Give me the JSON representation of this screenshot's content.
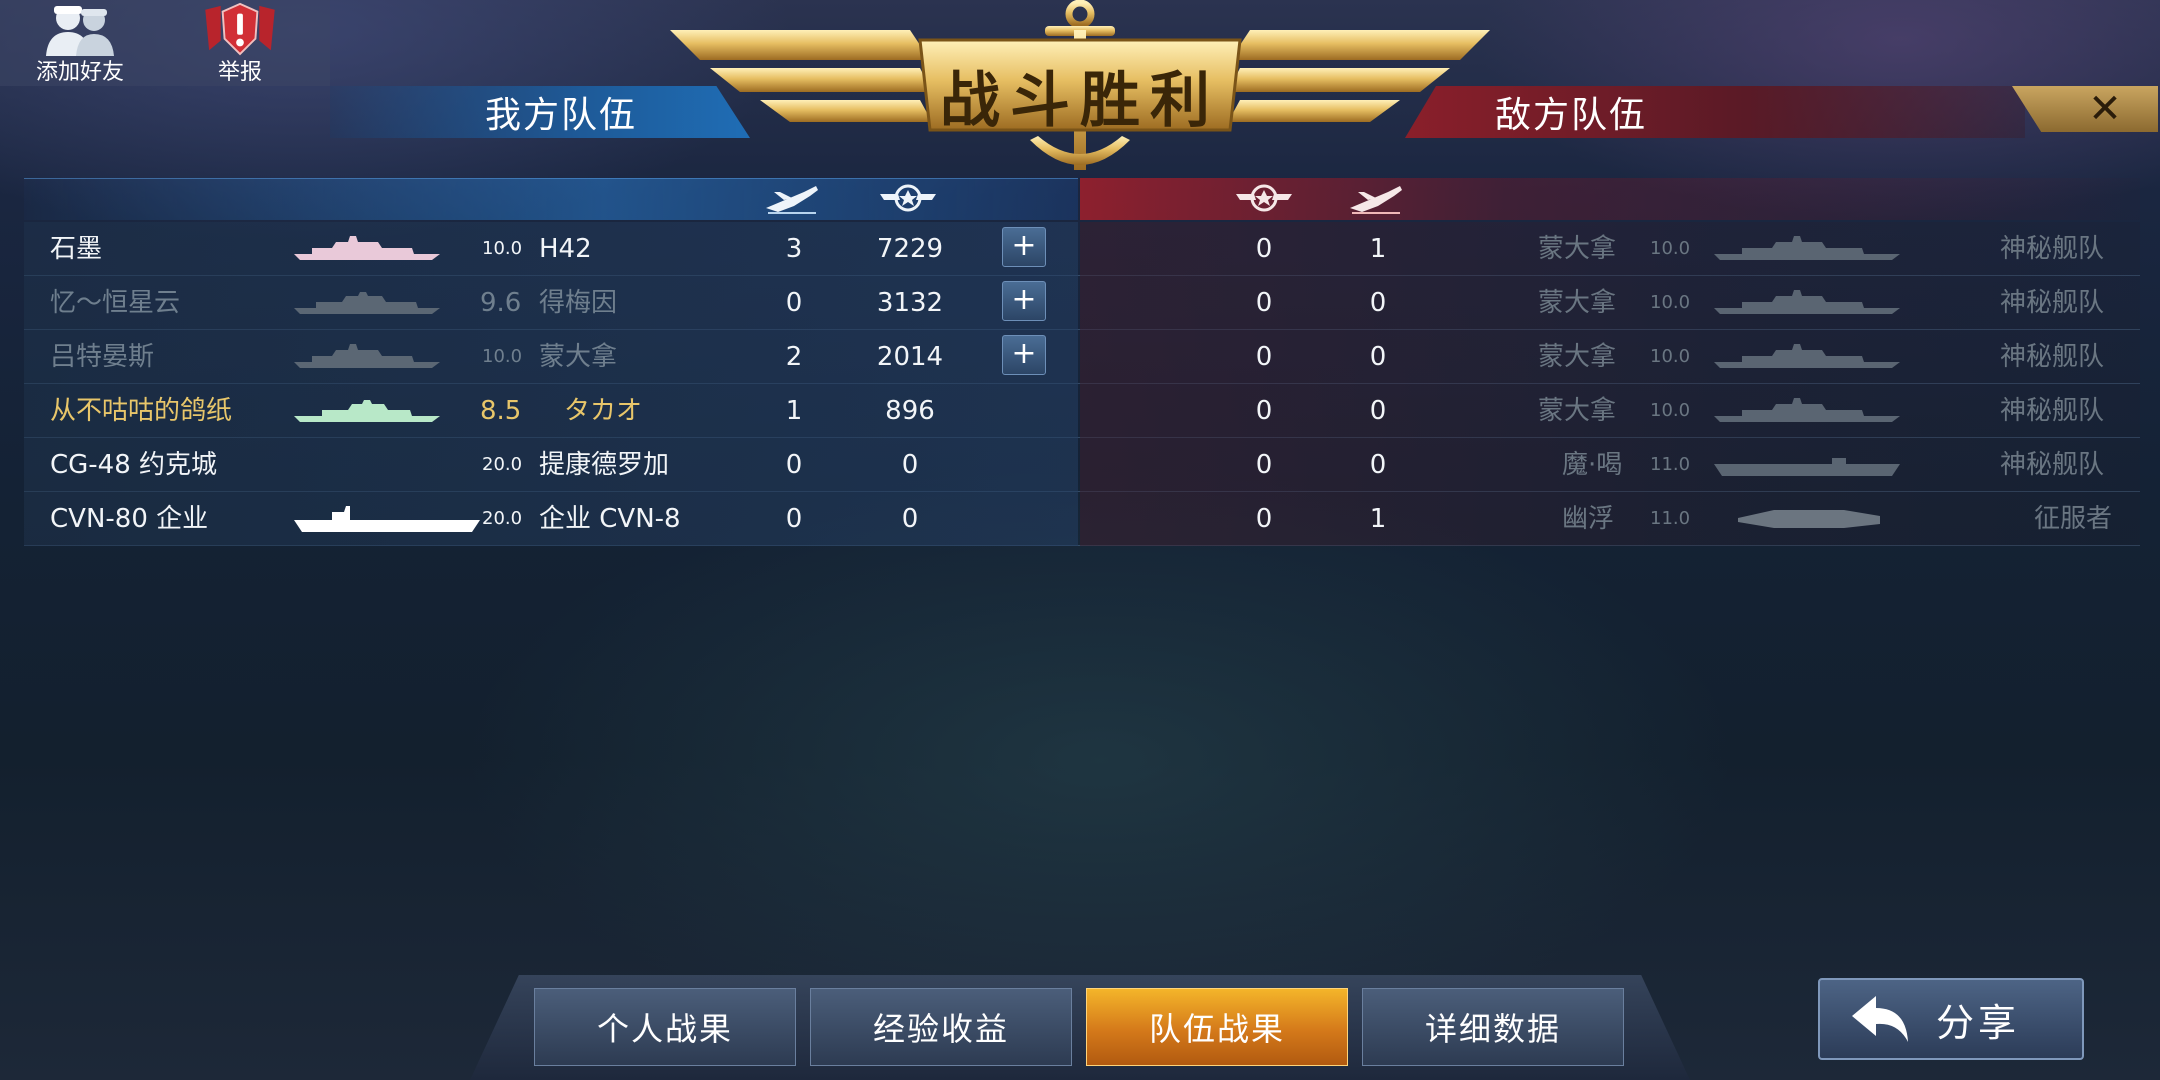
{
  "social": {
    "add_friend_label": "添加好友",
    "report_label": "举报"
  },
  "header": {
    "title": "战斗胜利",
    "ally_team_label": "我方队伍",
    "enemy_team_label": "敌方队伍",
    "close_symbol": "✕"
  },
  "icons": {
    "ally_kills": "plane-icon",
    "ally_score": "wings-emblem-icon",
    "enemy_score": "wings-emblem-icon",
    "enemy_kills": "plane-icon"
  },
  "ally_rows": [
    {
      "player": "石墨",
      "level": "10.0",
      "ship": "H42",
      "kills": "3",
      "score": "7229",
      "add_friend": true,
      "style": "white"
    },
    {
      "player": "忆～恒星云",
      "level": "9.6",
      "ship": "得梅因",
      "kills": "0",
      "score": "3132",
      "add_friend": true,
      "style": "gray"
    },
    {
      "player": "吕特晏斯",
      "level": "10.0",
      "ship": "蒙大拿",
      "kills": "2",
      "score": "2014",
      "add_friend": true,
      "style": "gray"
    },
    {
      "player": "从不咕咕的鸽纸",
      "level": "8.5",
      "ship": "タカオ",
      "kills": "1",
      "score": "896",
      "add_friend": false,
      "style": "gold"
    },
    {
      "player": "CG-48 约克城",
      "level": "20.0",
      "ship": "提康德罗加",
      "kills": "0",
      "score": "0",
      "add_friend": false,
      "style": "white"
    },
    {
      "player": "CVN-80 企业",
      "level": "20.0",
      "ship": "企业 CVN-8",
      "kills": "0",
      "score": "0",
      "add_friend": false,
      "style": "white"
    }
  ],
  "enemy_rows": [
    {
      "score": "0",
      "kills": "1",
      "ship": "蒙大拿",
      "level": "10.0",
      "player": "神秘舰队"
    },
    {
      "score": "0",
      "kills": "0",
      "ship": "蒙大拿",
      "level": "10.0",
      "player": "神秘舰队"
    },
    {
      "score": "0",
      "kills": "0",
      "ship": "蒙大拿",
      "level": "10.0",
      "player": "神秘舰队"
    },
    {
      "score": "0",
      "kills": "0",
      "ship": "蒙大拿",
      "level": "10.0",
      "player": "神秘舰队"
    },
    {
      "score": "0",
      "kills": "0",
      "ship": "魔·喝",
      "level": "11.0",
      "player": "神秘舰队"
    },
    {
      "score": "0",
      "kills": "1",
      "ship": "幽浮",
      "level": "11.0",
      "player": "征服者"
    }
  ],
  "add_friend_symbol": "+",
  "tabs": [
    {
      "label": "个人战果",
      "active": false
    },
    {
      "label": "经验收益",
      "active": false
    },
    {
      "label": "队伍战果",
      "active": true
    },
    {
      "label": "详细数据",
      "active": false
    }
  ],
  "share_label": "分享",
  "colors": {
    "ally_accent": "#1f6db5",
    "enemy_accent": "#8a1f2a",
    "active_tab": "#f4b52a",
    "gold_text": "#e8c66a"
  }
}
